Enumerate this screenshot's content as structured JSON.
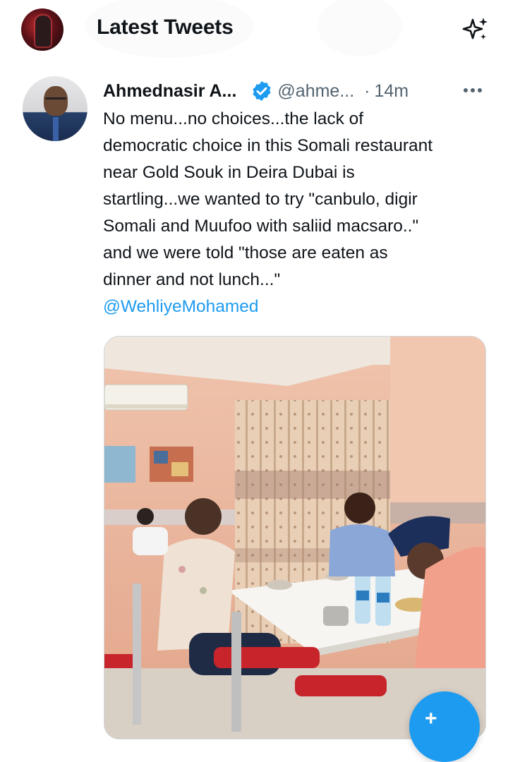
{
  "header": {
    "title": "Latest Tweets",
    "icons": {
      "avatar": "profile-avatar",
      "sparkle": "sparkle-icon"
    }
  },
  "tweet": {
    "author_name": "Ahmednasir A...",
    "handle": "@ahme...",
    "separator": "·",
    "time": "14m",
    "more": "•••",
    "text_lines": [
      "No menu...no choices...the lack of",
      "democratic choice in this Somali restaurant",
      "near Gold Souk in Deira Dubai is",
      "startling...we wanted to try \"canbulo, digir",
      "Somali and Muufoo with saliid macsaro..\"",
      "and we were told \"those are eaten as",
      "dinner and not lunch...\""
    ],
    "mention": "@WehliyeMohamed",
    "media_icon": "photo-restaurant"
  },
  "fab": {
    "label": "+",
    "icon": "compose-tweet-icon"
  },
  "colors": {
    "accent": "#1d9bf0",
    "secondary_text": "#536471",
    "text": "#0f1419"
  }
}
